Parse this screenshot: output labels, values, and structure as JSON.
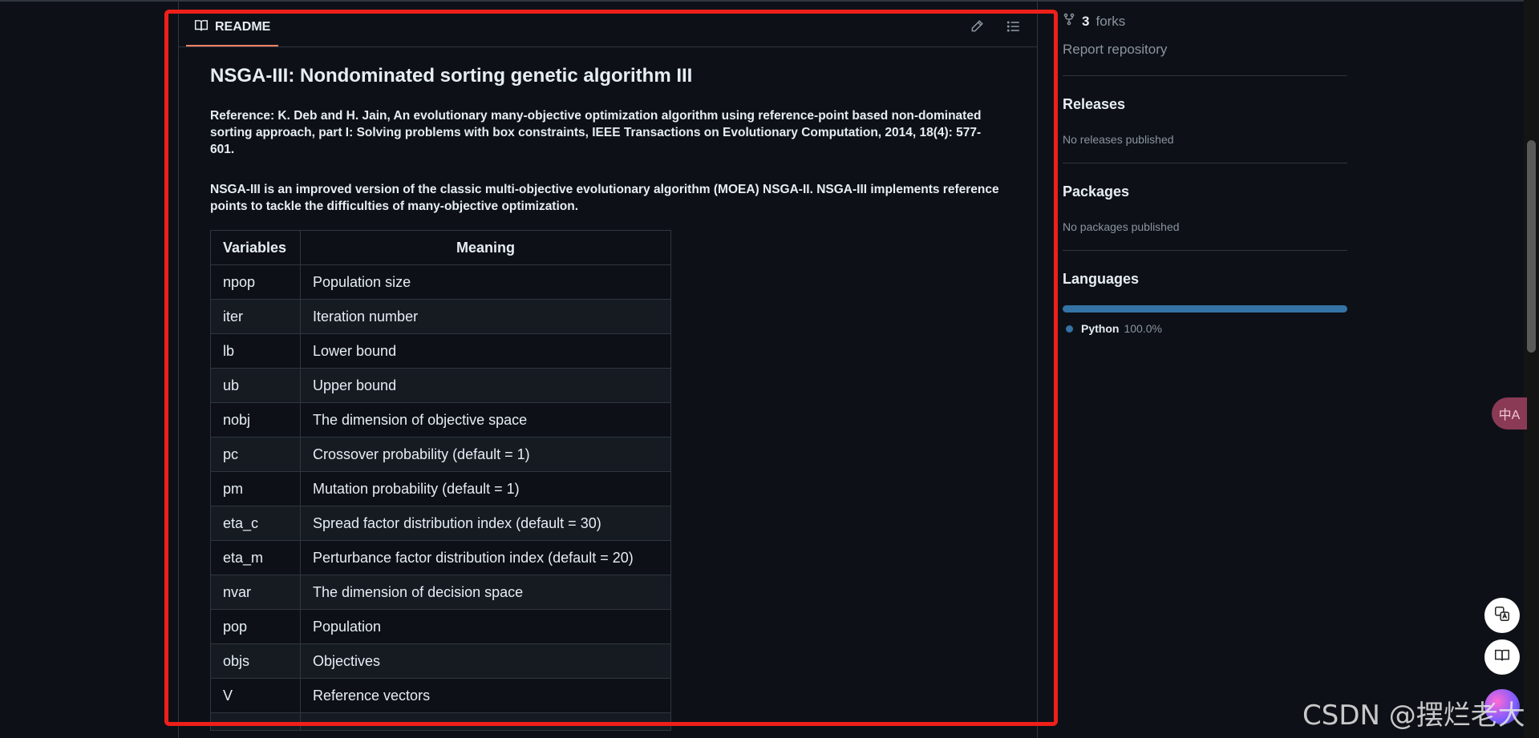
{
  "readme": {
    "tab_label": "README",
    "title": "NSGA-III: Nondominated sorting genetic algorithm III",
    "reference": "Reference: K. Deb and H. Jain, An evolutionary many-objective optimization algorithm using reference-point based non-dominated sorting approach, part I: Solving problems with box constraints, IEEE Transactions on Evolutionary Computation, 2014, 18(4): 577-601.",
    "description": "NSGA-III is an improved version of the classic multi-objective evolutionary algorithm (MOEA) NSGA-II. NSGA-III implements reference points to tackle the difficulties of many-objective optimization.",
    "table": {
      "headers": [
        "Variables",
        "Meaning"
      ],
      "rows": [
        [
          "npop",
          "Population size"
        ],
        [
          "iter",
          "Iteration number"
        ],
        [
          "lb",
          "Lower bound"
        ],
        [
          "ub",
          "Upper bound"
        ],
        [
          "nobj",
          "The dimension of objective space"
        ],
        [
          "pc",
          "Crossover probability (default = 1)"
        ],
        [
          "pm",
          "Mutation probability (default = 1)"
        ],
        [
          "eta_c",
          "Spread factor distribution index (default = 30)"
        ],
        [
          "eta_m",
          "Perturbance factor distribution index (default = 20)"
        ],
        [
          "nvar",
          "The dimension of decision space"
        ],
        [
          "pop",
          "Population"
        ],
        [
          "objs",
          "Objectives"
        ],
        [
          "V",
          "Reference vectors"
        ]
      ]
    }
  },
  "sidebar": {
    "forks_count": "3",
    "forks_label": "forks",
    "report_link": "Report repository",
    "releases_title": "Releases",
    "releases_empty": "No releases published",
    "packages_title": "Packages",
    "packages_empty": "No packages published",
    "languages_title": "Languages",
    "language_name": "Python",
    "language_percent": "100.0%"
  },
  "overlay": {
    "translate_glyph": "中A",
    "watermark": "CSDN @摆烂老大"
  },
  "colors": {
    "background": "#0d1117",
    "border": "#30363d",
    "highlight": "#ef1f1a",
    "python": "#3572a5",
    "tab_underline": "#f78166"
  },
  "icons": [
    "book-icon",
    "pencil-icon",
    "list-icon",
    "fork-icon",
    "translate-icon",
    "reader-icon"
  ]
}
